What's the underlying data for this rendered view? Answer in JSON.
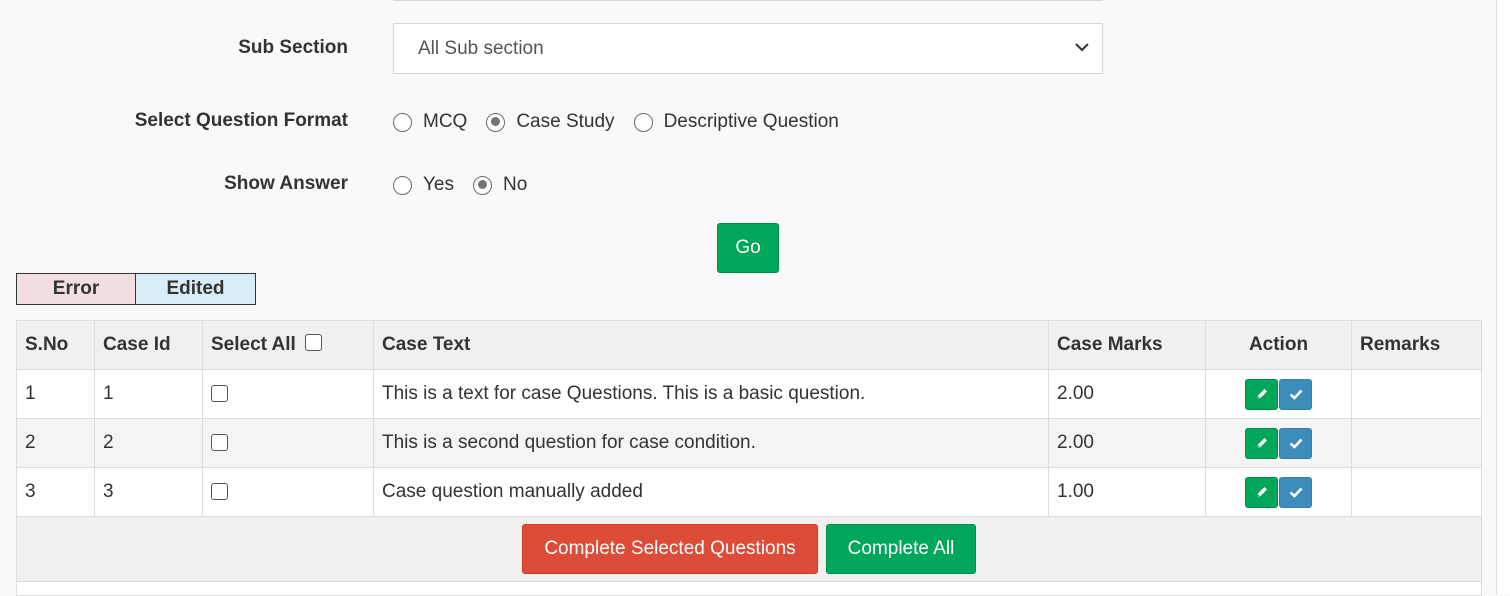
{
  "form": {
    "sub_section_label": "Sub Section",
    "sub_section_value": "All Sub section",
    "format_label": "Select Question Format",
    "format_options": [
      "MCQ",
      "Case Study",
      "Descriptive Question"
    ],
    "format_selected": "Case Study",
    "show_answer_label": "Show Answer",
    "show_answer_options": [
      "Yes",
      "No"
    ],
    "show_answer_selected": "No",
    "go_label": "Go"
  },
  "legend": {
    "error": "Error",
    "edited": "Edited"
  },
  "table": {
    "headers": [
      "S.No",
      "Case Id",
      "Select All",
      "Case Text",
      "Case Marks",
      "Action",
      "Remarks"
    ],
    "rows": [
      {
        "sno": "1",
        "case_id": "1",
        "text": "This is a text for case Questions. This is a basic question.",
        "marks": "2.00",
        "remarks": ""
      },
      {
        "sno": "2",
        "case_id": "2",
        "text": "This is a second question for case condition.",
        "marks": "2.00",
        "remarks": ""
      },
      {
        "sno": "3",
        "case_id": "3",
        "text": "Case question manually added",
        "marks": "1.00",
        "remarks": ""
      }
    ]
  },
  "footer": {
    "complete_selected_label": "Complete Selected Questions",
    "complete_all_label": "Complete All"
  },
  "colors": {
    "green": "#00a65a",
    "red": "#dd4b39",
    "blue": "#3c8dbc",
    "error_bg": "#f2dede",
    "edited_bg": "#d9edf7"
  },
  "icons": [
    "chevron-down-icon",
    "pencil-icon",
    "check-icon"
  ]
}
